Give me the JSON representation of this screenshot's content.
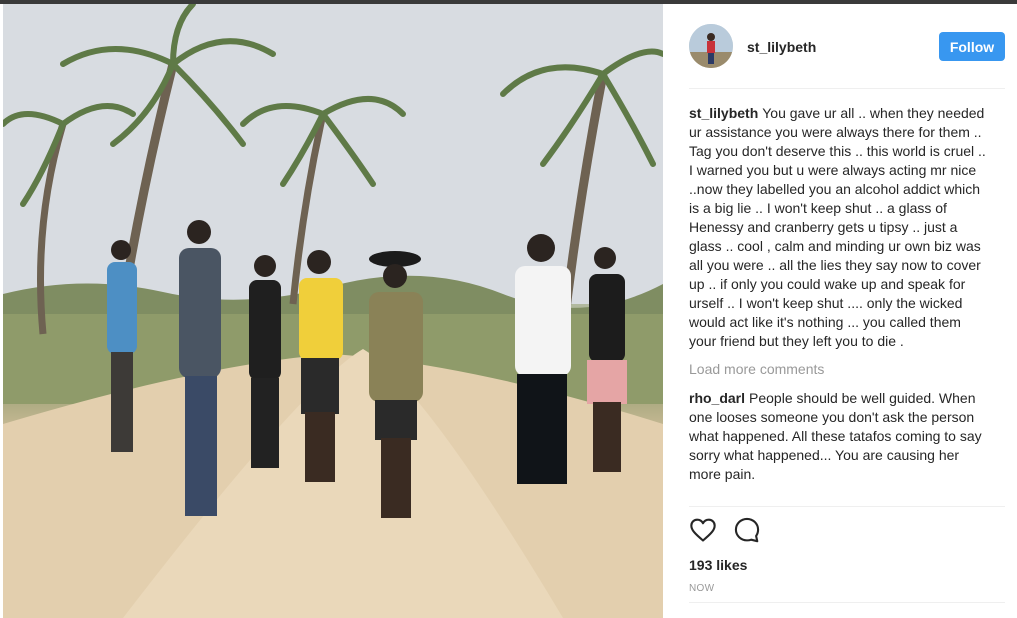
{
  "post": {
    "author": "st_lilybeth",
    "follow_label": "Follow",
    "caption": {
      "user": "st_lilybeth",
      "text": "You gave ur all .. when they needed ur assistance you were always there for them .. Tag you don't deserve this .. this world is cruel .. I warned you but u were always acting mr nice ..now they labelled you an alcohol addict which is a big lie .. I won't keep shut .. a glass of Henessy and cranberry gets u tipsy .. just a glass .. cool , calm and minding ur own biz was all you were .. all the lies they say now to cover up .. if only you could wake up and speak for urself .. I won't keep shut .... only the wicked would act like it's nothing ... you called them your friend but they left you to die ."
    },
    "load_more_label": "Load more comments",
    "comments": [
      {
        "user": "rho_darl",
        "text": "People should be well guided. When one looses someone you don't ask the person what happened. All these tatafos coming to say sorry what happened... You are causing her more pain."
      }
    ],
    "likes_label": "193 likes",
    "timestamp": "NOW"
  },
  "icons": {
    "like": "heart-icon",
    "comment": "comment-bubble-icon"
  },
  "colors": {
    "follow_button": "#3897f0",
    "muted_text": "#999999",
    "divider": "#efefef"
  }
}
